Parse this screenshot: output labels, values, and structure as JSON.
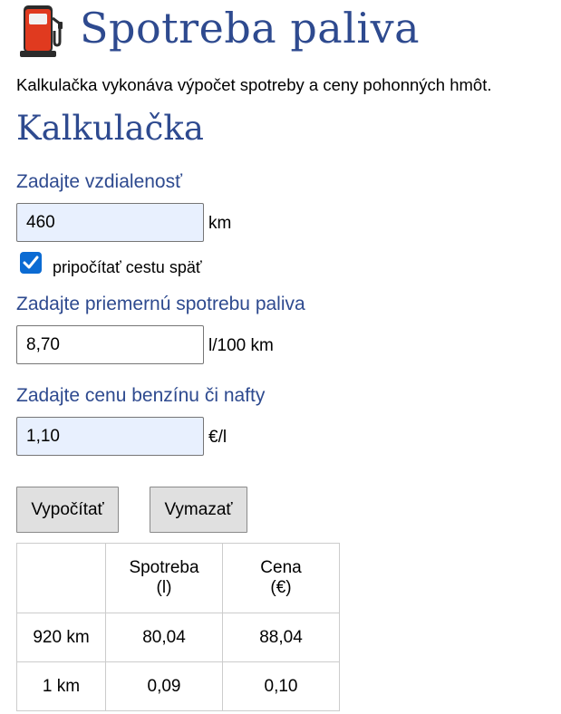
{
  "header": {
    "icon": "fuel-pump-icon",
    "title": "Spotreba paliva"
  },
  "intro": "Kalkulačka vykonáva výpočet spotreby a ceny pohonných hmôt.",
  "calculator": {
    "heading": "Kalkulačka",
    "distance": {
      "label": "Zadajte vzdialenosť",
      "value": "460",
      "unit": "km"
    },
    "return_trip": {
      "label": "pripočítať cestu späť",
      "checked": true
    },
    "consumption": {
      "label": "Zadajte priemernú spotrebu paliva",
      "value": "8,70",
      "unit": "l/100 km"
    },
    "price": {
      "label": "Zadajte cenu benzínu či nafty",
      "value": "1,10",
      "unit": "€/l"
    },
    "buttons": {
      "calculate": "Vypočítať",
      "clear": "Vymazať"
    }
  },
  "results": {
    "headers": [
      "",
      "Spotreba (l)",
      "Cena (€)"
    ],
    "header_lines": [
      [
        "",
        ""
      ],
      [
        "Spotreba",
        "(l)"
      ],
      [
        "Cena",
        "(€)"
      ]
    ],
    "rows": [
      [
        "920 km",
        "80,04",
        "88,04"
      ],
      [
        "1 km",
        "0,09",
        "0,10"
      ]
    ]
  },
  "colors": {
    "heading": "#2e4a8f",
    "input_filled_bg": "#e8f0fe",
    "checkbox": "#0b6bd3",
    "button_bg": "#e0e0e0",
    "pump_body": "#e03a1f"
  }
}
